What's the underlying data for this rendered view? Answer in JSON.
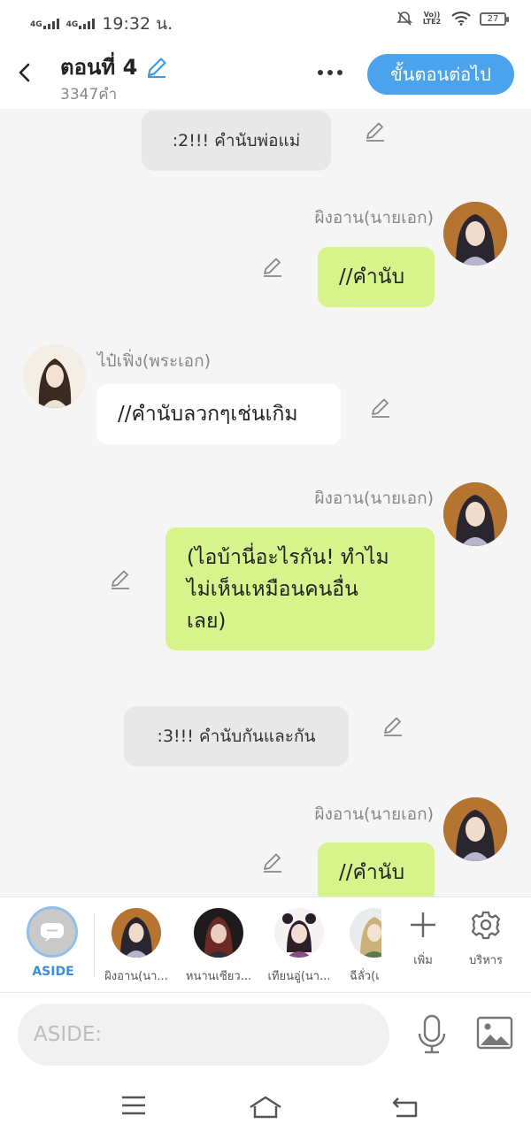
{
  "status_bar": {
    "net1": "4G",
    "net2": "4G",
    "time": "19:32 น.",
    "volte": "Vo)) LTE2",
    "battery": "27"
  },
  "header": {
    "title": "ตอนที่ 4",
    "word_count": "3347คำ",
    "next_button": "ขั้นตอนต่อไป"
  },
  "messages": {
    "aside1": ":2!!! คำนับพ่อแม่",
    "name1": "ผิงอาน(นายเอก)",
    "bubble1": "//คำนับ",
    "name2": "ไป๋เฟิ่ง(พระเอก)",
    "bubble2": "//คำนับลวกๆเช่นเกิม",
    "name3": "ผิงอาน(นายเอก)",
    "bubble3_line1": "(ไอบ้านี่อะไรกัน! ทำไม",
    "bubble3_line2": "ไม่เห็นเหมือนคนอื่น",
    "bubble3_line3": "เลย)",
    "aside2": ":3!!! คำนับกันและกัน",
    "name4": "ผิงอาน(นายเอก)",
    "bubble4": "//คำนับ"
  },
  "characters": {
    "aside_label": "ASIDE",
    "items": [
      {
        "label": "ผิงอาน(นา..."
      },
      {
        "label": "หนานเซียว..."
      },
      {
        "label": "เทียนอู่(นา..."
      },
      {
        "label": "ฉีลั่ว(เ"
      }
    ],
    "add_label": "เพิ่ม",
    "manage_label": "บริหาร"
  },
  "input": {
    "placeholder": "ASIDE:"
  },
  "colors": {
    "accent": "#4aa3ec",
    "bubble_green": "#d7f48c",
    "aside_gray": "#e8e8e8"
  }
}
